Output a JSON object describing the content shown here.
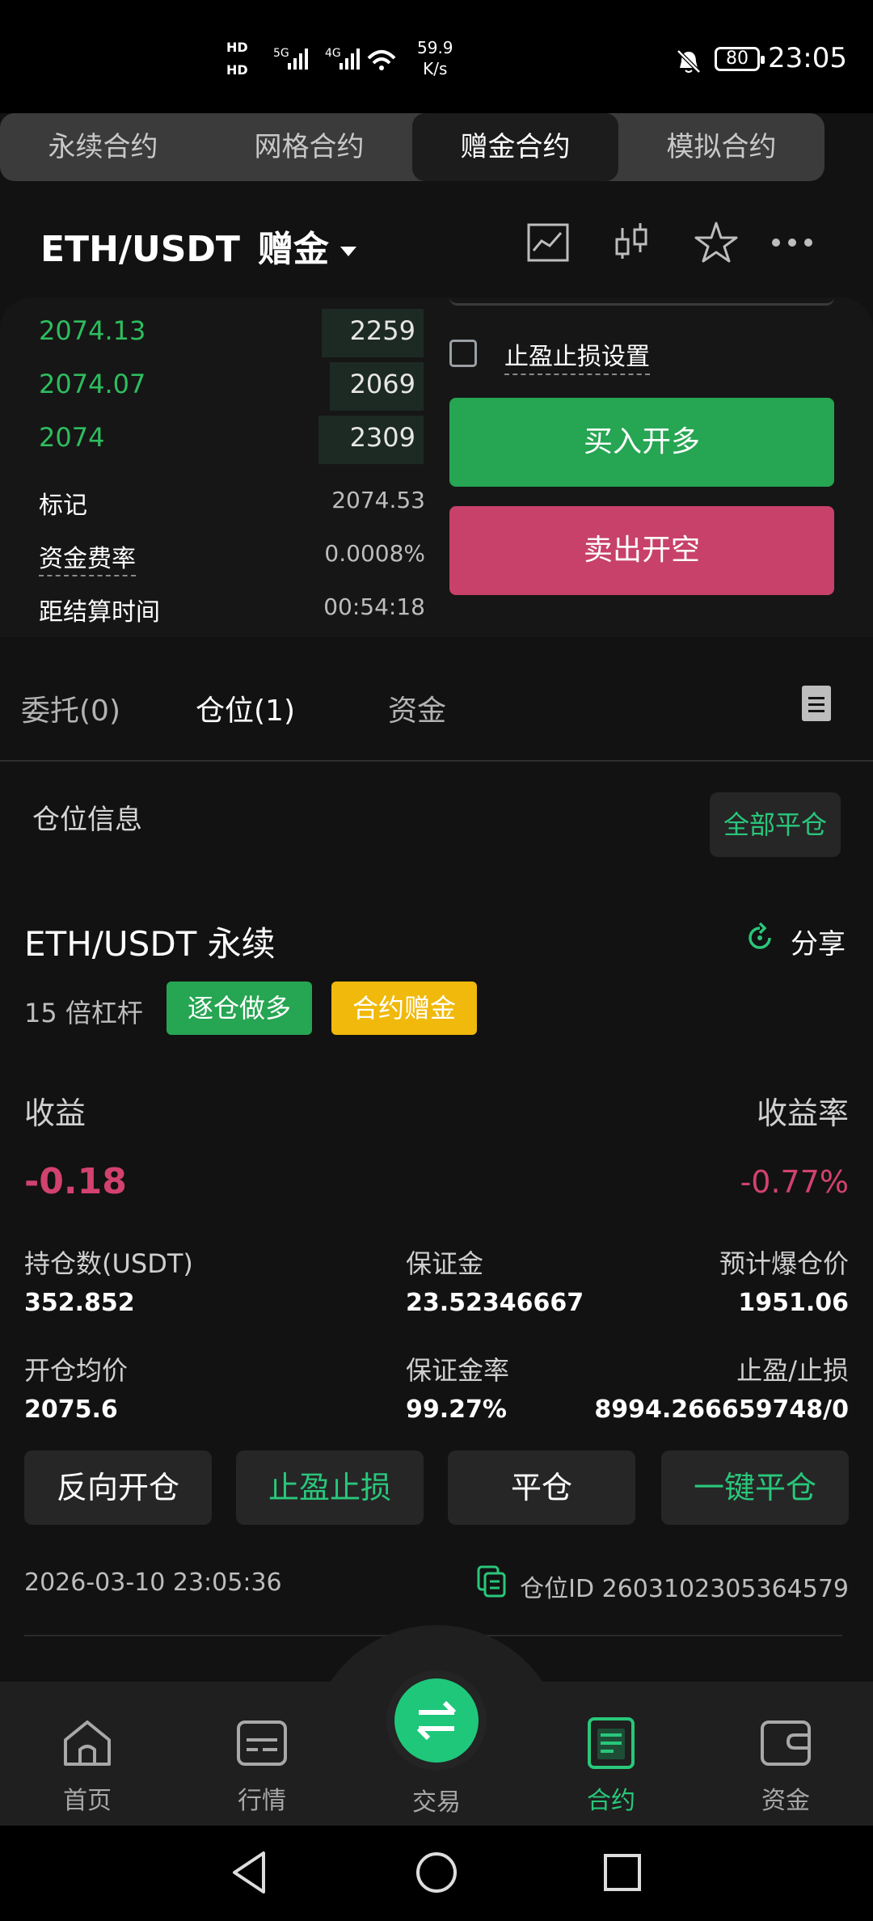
{
  "status_bar": {
    "network_label": "HD 5G 4G",
    "speed": "59.9",
    "speed_unit": "K/s",
    "battery": "80",
    "time": "23:05"
  },
  "top_tabs": [
    {
      "label": "永续合约",
      "active": false
    },
    {
      "label": "网格合约",
      "active": false
    },
    {
      "label": "赠金合约",
      "active": true
    },
    {
      "label": "模拟合约",
      "active": false
    }
  ],
  "pair": {
    "symbol": "ETH/USDT",
    "badge": "赠金"
  },
  "orderbook": [
    {
      "price": "2074.13",
      "qty": "2259"
    },
    {
      "price": "2074.07",
      "qty": "2069"
    },
    {
      "price": "2074",
      "qty": "2309"
    }
  ],
  "market_info": {
    "mark_label": "标记",
    "mark_value": "2074.53",
    "funding_label": "资金费率",
    "funding_value": "0.0008%",
    "settle_label": "距结算时间",
    "settle_value": "00:54:18"
  },
  "order_panel": {
    "tp_sl_label": "止盈止损设置",
    "buy_label": "买入开多",
    "sell_label": "卖出开空"
  },
  "tabs": [
    {
      "label": "委托(0)",
      "active": false
    },
    {
      "label": "仓位(1)",
      "active": true
    },
    {
      "label": "资金",
      "active": false
    }
  ],
  "position": {
    "section_title": "仓位信息",
    "close_all": "全部平仓",
    "symbol": "ETH/USDT 永续",
    "share": "分享",
    "leverage": "15 倍杠杆",
    "tag_side": "逐仓做多",
    "tag_bonus": "合约赠金",
    "pnl_label": "收益",
    "roe_label": "收益率",
    "pnl_value": "-0.18",
    "roe_value": "-0.77%",
    "size_label": "持仓数(USDT)",
    "size_value": "352.852",
    "margin_label": "保证金",
    "margin_value": "23.52346667",
    "liq_label": "预计爆仓价",
    "liq_value": "1951.06",
    "entry_label": "开仓均价",
    "entry_value": "2075.6",
    "margin_ratio_label": "保证金率",
    "margin_ratio_value": "99.27%",
    "tpsl_label": "止盈/止损",
    "tpsl_value": "8994.266659748/0",
    "btn_reverse": "反向开仓",
    "btn_tpsl": "止盈止损",
    "btn_close": "平仓",
    "btn_oneclick": "一键平仓",
    "open_time": "2026-03-10 23:05:36",
    "position_id": "仓位ID 2603102305364579"
  },
  "bottom_nav": [
    {
      "label": "首页",
      "icon": "home-icon"
    },
    {
      "label": "行情",
      "icon": "market-icon"
    },
    {
      "label": "交易",
      "icon": "trade-icon"
    },
    {
      "label": "合约",
      "icon": "contract-icon"
    },
    {
      "label": "资金",
      "icon": "wallet-icon"
    }
  ],
  "colors": {
    "green": "#26a552",
    "red": "#c7416a",
    "accent": "#29c77b",
    "gold": "#f0b90b"
  }
}
